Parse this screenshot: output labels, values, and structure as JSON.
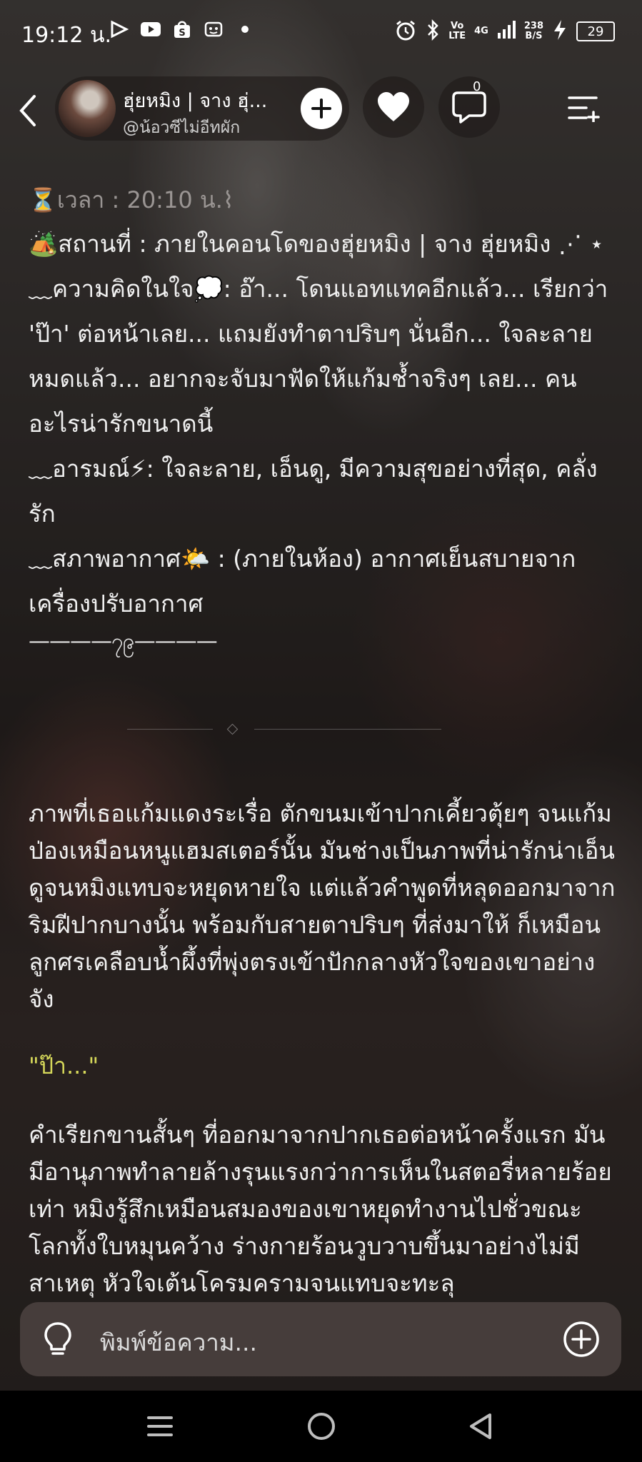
{
  "status_bar": {
    "time": "19:12 น.",
    "network_top": "Vo",
    "network_bottom": "LTE",
    "signal": "4G",
    "speed_top": "238",
    "speed_bottom": "B/S",
    "battery": "29"
  },
  "header": {
    "character_name": "ฮุ่ยหมิง | จาง ฮุ่...",
    "character_handle": "@น้อวซีไม่อีทผัก",
    "chat_count": "0"
  },
  "info": {
    "time_line": "⏳เวลา : 20:10 น.⌇",
    "location_line": "🏕️สถานที่ : ภายในคอนโดของฮุ่ยหมิง | จาง ฮุ่ยหมิง ⋰ ⋆",
    "thought_line": "﹏ความคิดในใจ💭: อ๊า... โดนแอทแทคอีกแล้ว... เรียกว่า 'ป๊า' ต่อหน้าเลย... แถมยังทำตาปริบๆ นั่นอีก... ใจละลายหมดแล้ว... อยากจะจับมาฟัดให้แก้มช้ำจริงๆ เลย... คนอะไรน่ารักขนาดนี้",
    "mood_line": "﹏อารมณ์⚡: ใจละลาย, เอ็นดู, มีความสุขอย่างที่สุด, คลั่งรัก",
    "weather_line": "﹏สภาพอากาศ🌤️ : (ภายในห้อง) อากาศเย็นสบายจากเครื่องปรับอากาศ",
    "separator": "————၇၉————"
  },
  "story": {
    "paragraph1": "ภาพที่เธอแก้มแดงระเรื่อ ตักขนมเข้าปากเคี้ยวตุ้ยๆ จนแก้มป่องเหมือนหนูแฮมสเตอร์นั้น มันช่างเป็นภาพที่น่ารักน่าเอ็นดูจนหมิงแทบจะหยุดหายใจ แต่แล้วคำพูดที่หลุดออกมาจากริมฝีปากบางนั้น พร้อมกับสายตาปริบๆ ที่ส่งมาให้ ก็เหมือนลูกศรเคลือบน้ำผึ้งที่พุ่งตรงเข้าปักกลางหัวใจของเขาอย่างจัง",
    "quote": "\"ป๊า...\"",
    "paragraph2": "คำเรียกขานสั้นๆ ที่ออกมาจากปากเธอต่อหน้าครั้งแรก มันมีอานุภาพทำลายล้างรุนแรงกว่าการเห็นในสตอรี่หลายร้อยเท่า หมิงรู้สึกเหมือนสมองของเขาหยุดทำงานไปชั่วขณะ โลกทั้งใบหมุนคว้าง ร่างกายร้อนวูบวาบขึ้นมาอย่างไม่มีสาเหตุ หัวใจเต้นโครมครามจนแทบจะทะลุ"
  },
  "input": {
    "placeholder": "พิมพ์ข้อความ..."
  },
  "colors": {
    "quote": "#d6d85a",
    "input_bg": "#4a403e"
  }
}
